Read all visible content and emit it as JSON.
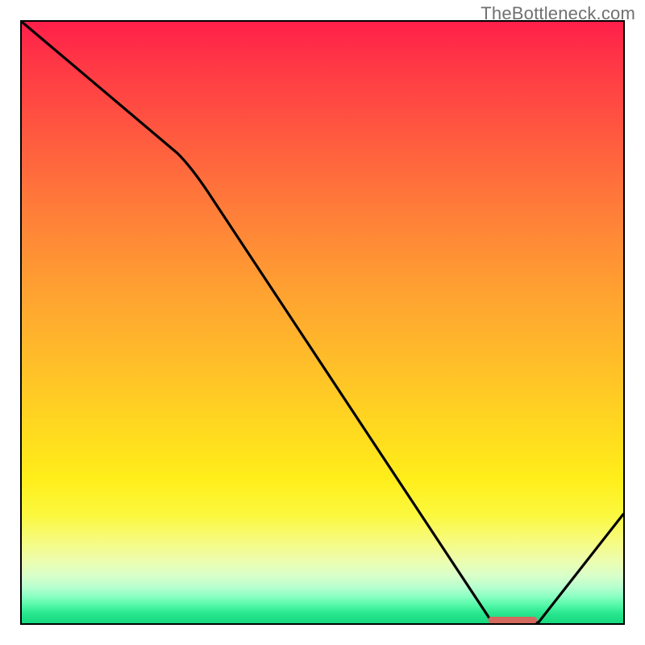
{
  "watermark": "TheBottleneck.com",
  "chart_data": {
    "type": "line",
    "title": "",
    "xlabel": "",
    "ylabel": "",
    "xlim": [
      0,
      100
    ],
    "ylim": [
      0,
      100
    ],
    "series": [
      {
        "name": "bottleneck-curve",
        "x": [
          0,
          26,
          78,
          86,
          100
        ],
        "values": [
          100,
          78,
          0.5,
          0.5,
          18
        ]
      }
    ],
    "marker": {
      "type": "bar",
      "x_range": [
        77.5,
        85.5
      ],
      "y": 0.5,
      "color": "#d46a5f"
    },
    "gradient_stops": [
      {
        "pos": 0.0,
        "color": "#ff1f4a"
      },
      {
        "pos": 0.5,
        "color": "#ffb22c"
      },
      {
        "pos": 0.82,
        "color": "#f9fa58"
      },
      {
        "pos": 1.0,
        "color": "#16d97f"
      }
    ]
  }
}
